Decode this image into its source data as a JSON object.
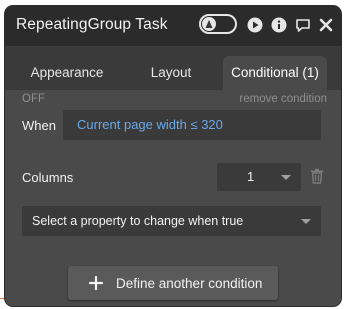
{
  "window": {
    "title": "RepeatingGroup Task"
  },
  "tabs": [
    {
      "label": "Appearance",
      "active": false
    },
    {
      "label": "Layout",
      "active": false
    },
    {
      "label": "Conditional (1)",
      "active": true
    }
  ],
  "condition": {
    "status": "OFF",
    "remove_label": "remove condition",
    "when_label": "When",
    "expression": "Current page width ≤ 320"
  },
  "columns": {
    "label": "Columns",
    "value": "1"
  },
  "property_select": {
    "placeholder": "Select a property to change when true"
  },
  "define_button": {
    "label": "Define another condition"
  },
  "icons": [
    "toggle-icon",
    "play-icon",
    "info-icon",
    "comment-icon",
    "close-icon",
    "trash-icon",
    "plus-icon",
    "chevron-down-icon"
  ],
  "colors": {
    "accent_link": "#6aa8e8",
    "panel_bg": "#3a3a3a",
    "content_bg": "#4a4a4a"
  }
}
